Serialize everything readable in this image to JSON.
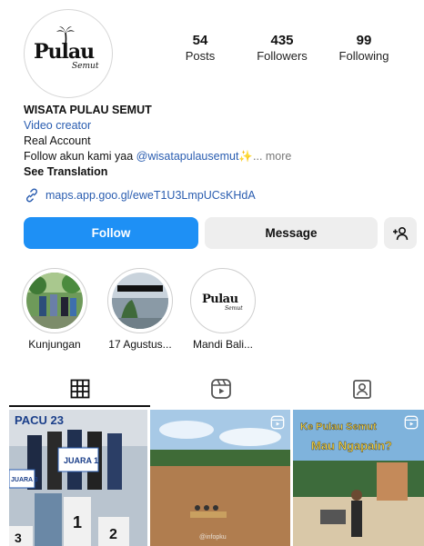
{
  "profile": {
    "logo_text": "Pulau",
    "logo_sub": "Semut",
    "stats": {
      "posts": {
        "value": "54",
        "label": "Posts"
      },
      "followers": {
        "value": "435",
        "label": "Followers"
      },
      "following": {
        "value": "99",
        "label": "Following"
      }
    },
    "name": "WISATA PULAU SEMUT",
    "category": "Video creator",
    "bio_line": "Real Account",
    "bio_follow_prefix": "Follow akun kami yaa ",
    "bio_mention": "@wisatapulausemut",
    "bio_sparkle": "✨",
    "bio_more": "... more",
    "see_translation": "See Translation",
    "link": "maps.app.goo.gl/eweT1U3LmpUCsKHdA"
  },
  "actions": {
    "follow_label": "Follow",
    "message_label": "Message",
    "add_icon": "add-person-icon"
  },
  "highlights": [
    {
      "label": "Kunjungan"
    },
    {
      "label": "17 Agustus..."
    },
    {
      "label": "Mandi Bali..."
    }
  ],
  "tabs": [
    {
      "icon": "grid-icon"
    },
    {
      "icon": "reels-icon"
    },
    {
      "icon": "tagged-icon"
    }
  ],
  "posts": [
    {
      "overlay_text": "PACU 23",
      "badge_1": "JUARA 1",
      "badge_3": "JUARA 3"
    },
    {
      "watermark": "@infopku"
    },
    {
      "overlay_text_1": "Ke Pulau Semut",
      "overlay_text_2": "Mau Ngapain?"
    }
  ],
  "colors": {
    "accent": "#1e90f5",
    "link": "#2a5db0",
    "button_gray": "#eeeeee"
  }
}
